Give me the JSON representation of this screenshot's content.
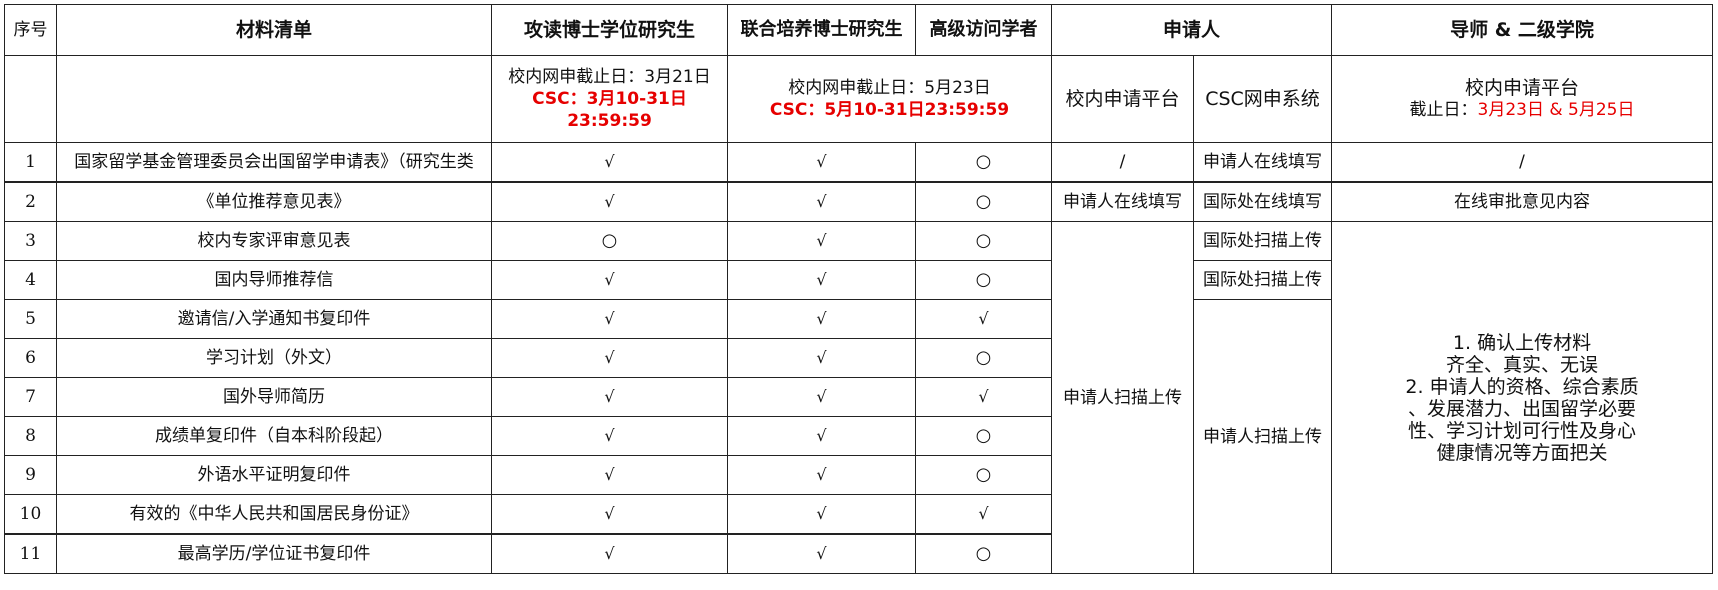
{
  "header": {
    "index": "序号",
    "materials": "材料清单",
    "phd_degree": "攻读博士学位研究生",
    "joint_phd": "联合培养博士研究生",
    "visiting": "高级访问学者",
    "applicant": "申请人",
    "supervisor": "导师 & 二级学院"
  },
  "subheader": {
    "phd_deadline": "校内网申截止日：3月21日",
    "phd_csc_1": "CSC：3月10-31日",
    "phd_csc_2": "23:59:59",
    "joint_deadline": "校内网申截止日：5月23日",
    "joint_csc": "CSC：5月10-31日23:59:59",
    "campus_platform": "校内申请平台",
    "csc_system": "CSC网申系统",
    "sup_platform": "校内申请平台",
    "sup_deadline_label": "截止日：",
    "sup_deadline_dates": "3月23日 & 5月25日"
  },
  "rows": [
    {
      "no": "1",
      "name": "国家留学基金管理委员会出国留学申请表》（研究生类",
      "phd": "√",
      "joint": "√",
      "visit": "○"
    },
    {
      "no": "2",
      "name": "《单位推荐意见表》",
      "phd": "√",
      "joint": "√",
      "visit": "○"
    },
    {
      "no": "3",
      "name": "校内专家评审意见表",
      "phd": "○",
      "joint": "√",
      "visit": "○"
    },
    {
      "no": "4",
      "name": "国内导师推荐信",
      "phd": "√",
      "joint": "√",
      "visit": "○"
    },
    {
      "no": "5",
      "name": "邀请信/入学通知书复印件",
      "phd": "√",
      "joint": "√",
      "visit": "√"
    },
    {
      "no": "6",
      "name": "学习计划（外文）",
      "phd": "√",
      "joint": "√",
      "visit": "○"
    },
    {
      "no": "7",
      "name": "国外导师简历",
      "phd": "√",
      "joint": "√",
      "visit": "√"
    },
    {
      "no": "8",
      "name": "成绩单复印件（自本科阶段起）",
      "phd": "√",
      "joint": "√",
      "visit": "○"
    },
    {
      "no": "9",
      "name": "外语水平证明复印件",
      "phd": "√",
      "joint": "√",
      "visit": "○"
    },
    {
      "no": "10",
      "name": "有效的《中华人民共和国居民身份证》",
      "phd": "√",
      "joint": "√",
      "visit": "√"
    },
    {
      "no": "11",
      "name": "最高学历/学位证书复印件",
      "phd": "√",
      "joint": "√",
      "visit": "○"
    }
  ],
  "applicant_cells": {
    "r1_campus": "/",
    "r1_csc": "申请人在线填写",
    "r1_sup": "/",
    "r2_campus": "申请人在线填写",
    "r2_csc": "国际处在线填写",
    "r2_sup": "在线审批意见内容",
    "r3_csc": "国际处扫描上传",
    "r4_csc": "国际处扫描上传",
    "campus_merged": "申请人扫描上传",
    "csc_merged": "申请人扫描上传"
  },
  "supervisor_note": {
    "line1": "1. 确认上传材料",
    "line2": "齐全、真实、无误",
    "line3": "2. 申请人的资格、综合素质",
    "line4": "、发展潜力、出国留学必要",
    "line5": "性、学习计划可行性及身心",
    "line6": "健康情况等方面把关"
  }
}
